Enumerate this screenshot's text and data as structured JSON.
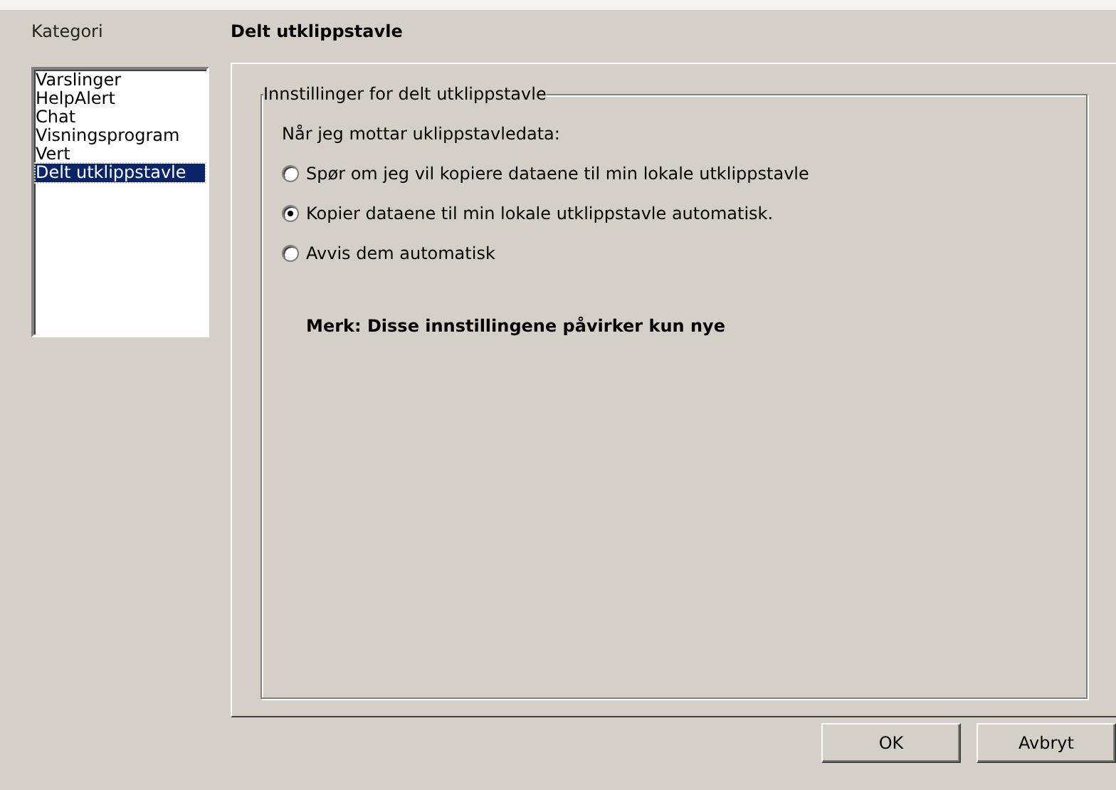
{
  "category_label": "Kategori",
  "categories": [
    {
      "label": "Varslinger",
      "selected": false
    },
    {
      "label": "HelpAlert",
      "selected": false
    },
    {
      "label": "Chat",
      "selected": false
    },
    {
      "label": "Visningsprogram",
      "selected": false
    },
    {
      "label": "Vert",
      "selected": false
    },
    {
      "label": "Delt utklippstavle",
      "selected": true
    }
  ],
  "page_title": "Delt utklippstavle",
  "group": {
    "title": "Innstillinger for delt utklippstavle",
    "prompt": "Når jeg mottar uklippstavledata:",
    "options": [
      {
        "label": "Spør om jeg vil kopiere dataene til min lokale utklippstavle",
        "selected": false
      },
      {
        "label": "Kopier dataene til min lokale utklippstavle automatisk.",
        "selected": true
      },
      {
        "label": "Avvis dem automatisk",
        "selected": false
      }
    ],
    "note": "Merk: Disse innstillingene påvirker kun nye"
  },
  "buttons": [
    "OK",
    "Avbryt"
  ]
}
